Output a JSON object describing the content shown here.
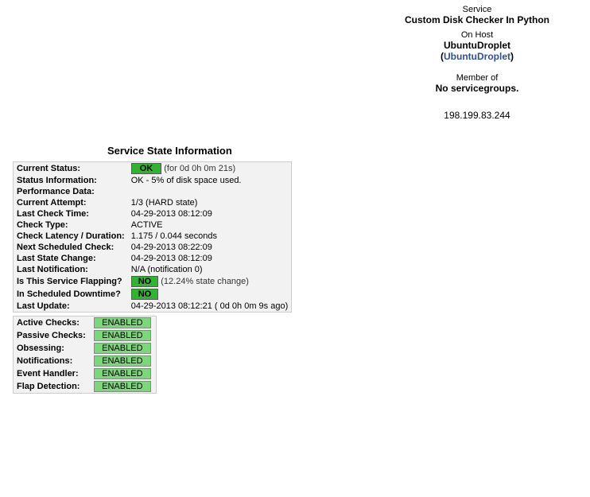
{
  "header": {
    "service_label": "Service",
    "service_name": "Custom Disk Checker In Python",
    "onhost_label": "On Host",
    "host_name": "UbuntuDroplet",
    "host_link": "UbuntuDroplet",
    "memberof_label": "Member of",
    "memberof_value": "No servicegroups.",
    "ip": "198.199.83.244"
  },
  "section_title": "Service State Information",
  "state": {
    "current_status_label": "Current Status:",
    "current_status_tag": "OK",
    "current_status_note": "(for 0d 0h 0m 21s)",
    "status_info_label": "Status Information:",
    "status_info_value": "OK - 5% of disk space used.",
    "perf_label": "Performance Data:",
    "perf_value": "",
    "attempt_label": "Current Attempt:",
    "attempt_value": "1/3  (HARD state)",
    "lastcheck_label": "Last Check Time:",
    "lastcheck_value": "04-29-2013 08:12:09",
    "checktype_label": "Check Type:",
    "checktype_value": "ACTIVE",
    "latency_label": "Check Latency / Duration:",
    "latency_value": "1.175 / 0.044 seconds",
    "nextcheck_label": "Next Scheduled Check:",
    "nextcheck_value": "04-29-2013 08:22:09",
    "laststate_label": "Last State Change:",
    "laststate_value": "04-29-2013 08:12:09",
    "lastnotif_label": "Last Notification:",
    "lastnotif_value": "N/A (notification 0)",
    "flapping_label": "Is This Service Flapping?",
    "flapping_tag": "NO",
    "flapping_note": "(12.24% state change)",
    "downtime_label": "In Scheduled Downtime?",
    "downtime_tag": "NO",
    "lastupdate_label": "Last Update:",
    "lastupdate_value": "04-29-2013 08:12:21  ( 0d 0h 0m 9s ago)"
  },
  "checks": {
    "active_label": "Active Checks:",
    "active_value": "ENABLED",
    "passive_label": "Passive Checks:",
    "passive_value": "ENABLED",
    "obsessing_label": "Obsessing:",
    "obsessing_value": "ENABLED",
    "notifications_label": "Notifications:",
    "notifications_value": "ENABLED",
    "eventhandler_label": "Event Handler:",
    "eventhandler_value": "ENABLED",
    "flapdetect_label": "Flap Detection:",
    "flapdetect_value": "ENABLED"
  }
}
